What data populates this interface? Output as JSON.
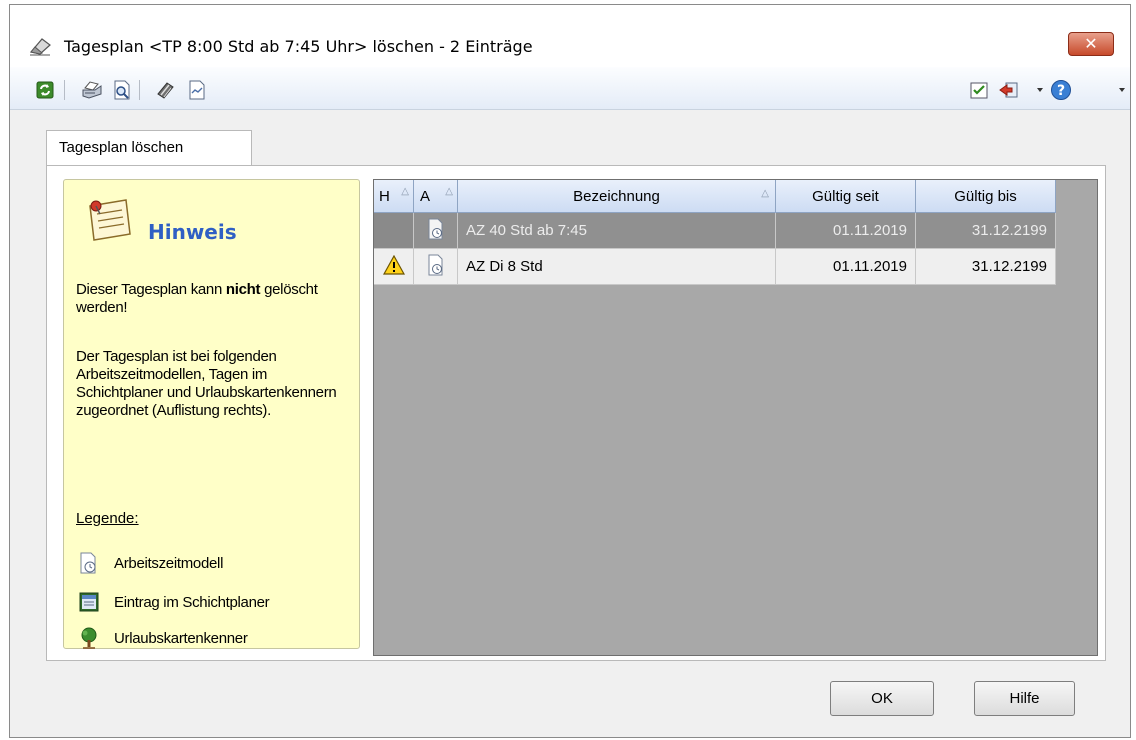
{
  "window": {
    "title": "Tagesplan <TP 8:00 Std ab 7:45 Uhr> löschen - 2 Einträge",
    "close_label": "✕"
  },
  "toolbar": {
    "icons": [
      "refresh-icon",
      "print-icon",
      "print-preview-icon",
      "tools-icon",
      "chart-icon",
      "checklist-icon",
      "exit-icon",
      "help-icon"
    ]
  },
  "tabs": [
    {
      "label": "Tagesplan löschen",
      "active": true
    }
  ],
  "hint": {
    "title": "Hinweis",
    "p1_before": "Dieser Tagesplan kann ",
    "p1_bold": "nicht",
    "p1_after": " gelöscht werden!",
    "p2": "Der Tagesplan ist bei folgenden Arbeitszeitmodellen, Tagen im Schichtplaner und Urlaubskartenkennern zugeordnet (Auflistung rechts).",
    "legend_title": "Legende:",
    "legend": [
      {
        "label": "Arbeitszeitmodell",
        "icon": "work-time-model-icon"
      },
      {
        "label": "Eintrag im Schichtplaner",
        "icon": "shift-planner-icon"
      },
      {
        "label": "Urlaubskartenkenner",
        "icon": "vacation-tree-icon"
      }
    ]
  },
  "grid": {
    "columns": [
      "H",
      "A",
      "Bezeichnung",
      "Gültig seit",
      "Gültig bis"
    ],
    "rows": [
      {
        "warning": false,
        "name": "AZ 40 Std ab 7:45",
        "valid_from": "01.11.2019",
        "valid_to": "31.12.2199",
        "selected": true
      },
      {
        "warning": true,
        "name": "AZ Di 8 Std",
        "valid_from": "01.11.2019",
        "valid_to": "31.12.2199",
        "selected": false
      }
    ]
  },
  "buttons": {
    "ok": "OK",
    "help": "Hilfe"
  },
  "colors": {
    "hint_background": "#ffffc8",
    "hint_title": "#2f5fc4",
    "selected_row": "#909090",
    "grid_background": "#a8a8a8"
  }
}
